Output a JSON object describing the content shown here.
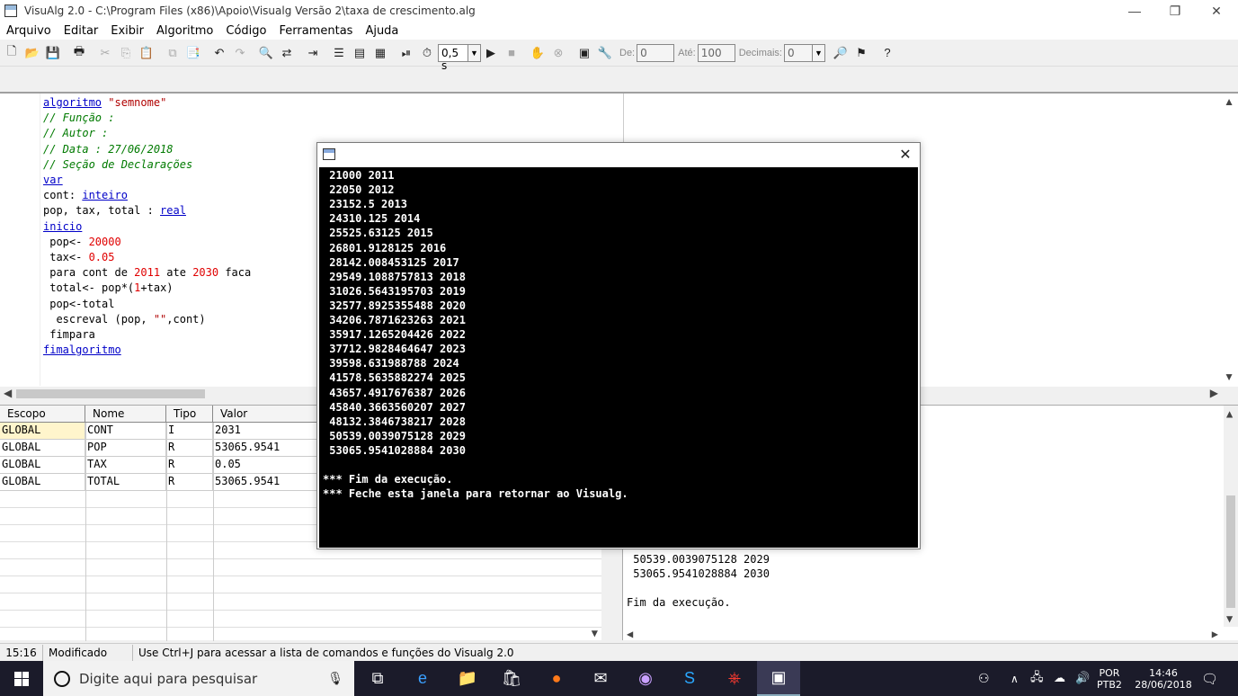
{
  "window": {
    "title": "VisuAlg 2.0 - C:\\Program Files (x86)\\Apoio\\Visualg Versão 2\\taxa de crescimento.alg",
    "minimize": "—",
    "maximize": "❐",
    "close": "✕"
  },
  "menu": [
    "Arquivo",
    "Editar",
    "Exibir",
    "Algoritmo",
    "Código",
    "Ferramentas",
    "Ajuda"
  ],
  "toolbar": {
    "speed_value": "0,5 s",
    "de_label": "De:",
    "de_value": "0",
    "ate_label": "Até:",
    "ate_value": "100",
    "decimais_label": "Decimais:",
    "decimais_value": "0"
  },
  "code": {
    "l1_kw": "algoritmo",
    "l1_str": "\"semnome\"",
    "l2": "// Função :",
    "l3": "// Autor :",
    "l4": "// Data : 27/06/2018",
    "l5": "// Seção de Declarações",
    "l6_kw": "var",
    "l7_a": "cont: ",
    "l7_kw": "inteiro",
    "l8_a": "pop, tax, total : ",
    "l8_kw": "real",
    "l9_kw": "inicio",
    "l10_a": " pop<- ",
    "l10_num": "20000",
    "l11_a": " tax<- ",
    "l11_num": "0.05",
    "l12_a": " para cont de ",
    "l12_n1": "2011",
    "l12_b": " ate ",
    "l12_n2": "2030",
    "l12_c": " faca",
    "l13_a": " total<- pop*(",
    "l13_num": "1",
    "l13_b": "+tax)",
    "l14": " pop<-total",
    "l15_a": "  escreval (pop, ",
    "l15_str": "\"\"",
    "l15_b": ",cont)",
    "l16": " fimpara",
    "l17_kw": "fimalgoritmo"
  },
  "vars_table": {
    "headers": [
      "Escopo",
      "Nome",
      "Tipo",
      "Valor"
    ],
    "rows": [
      {
        "escopo": "GLOBAL",
        "nome": "CONT",
        "tipo": "I",
        "valor": "2031"
      },
      {
        "escopo": "GLOBAL",
        "nome": "POP",
        "tipo": "R",
        "valor": "53065.9541"
      },
      {
        "escopo": "GLOBAL",
        "nome": "TAX",
        "tipo": "R",
        "valor": "0.05"
      },
      {
        "escopo": "GLOBAL",
        "nome": "TOTAL",
        "tipo": "R",
        "valor": "53065.9541"
      }
    ]
  },
  "output_panel": {
    "lines": [
      " 50539.0039075128 2029",
      " 53065.9541028884 2030",
      "",
      "Fim da execução."
    ]
  },
  "console": {
    "lines": [
      " 21000 2011",
      " 22050 2012",
      " 23152.5 2013",
      " 24310.125 2014",
      " 25525.63125 2015",
      " 26801.9128125 2016",
      " 28142.008453125 2017",
      " 29549.1088757813 2018",
      " 31026.5643195703 2019",
      " 32577.8925355488 2020",
      " 34206.7871623263 2021",
      " 35917.1265204426 2022",
      " 37712.9828464647 2023",
      " 39598.631988788 2024",
      " 41578.5635882274 2025",
      " 43657.4917676387 2026",
      " 45840.3663560207 2027",
      " 48132.3846738217 2028",
      " 50539.0039075128 2029",
      " 53065.9541028884 2030",
      "",
      "*** Fim da execução.",
      "*** Feche esta janela para retornar ao Visualg."
    ]
  },
  "statusbar": {
    "position": "15:16",
    "state": "Modificado",
    "hint": "Use Ctrl+J para acessar a lista de comandos e funções do Visualg 2.0"
  },
  "taskbar": {
    "search_placeholder": "Digite aqui para pesquisar",
    "lang_top": "POR",
    "lang_bottom": "PTB2",
    "time": "14:46",
    "date": "28/06/2018"
  }
}
